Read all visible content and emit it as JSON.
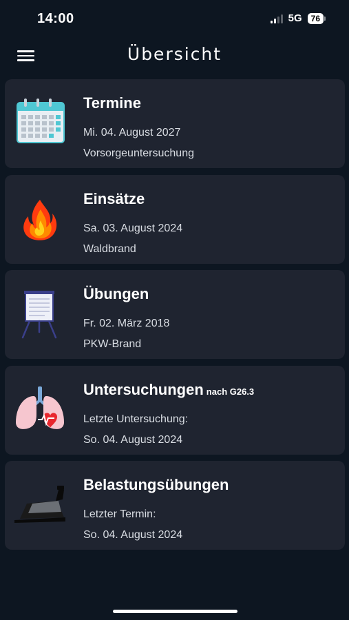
{
  "status_bar": {
    "time": "14:00",
    "network": "5G",
    "battery": "76"
  },
  "header": {
    "title": "Übersicht",
    "menu_icon": "hamburger-menu-icon"
  },
  "cards": [
    {
      "icon": "calendar-icon",
      "title": "Termine",
      "title_suffix": "",
      "line1": "Mi. 04. August 2027",
      "line2": "Vorsorgeuntersuchung"
    },
    {
      "icon": "fire-icon",
      "title": "Einsätze",
      "title_suffix": "",
      "line1": "Sa. 03. August 2024",
      "line2": "Waldbrand"
    },
    {
      "icon": "flipchart-icon",
      "title": "Übungen",
      "title_suffix": "",
      "line1": "Fr. 02. März 2018",
      "line2": "PKW-Brand"
    },
    {
      "icon": "lungs-heart-icon",
      "title": "Untersuchungen",
      "title_suffix": "nach G26.3",
      "line1": "Letzte Untersuchung:",
      "line2": "So. 04. August 2024"
    },
    {
      "icon": "treadmill-icon",
      "title": "Belastungsübungen",
      "title_suffix": "",
      "line1": "Letzter Termin:",
      "line2": "So. 04. August 2024"
    }
  ],
  "colors": {
    "background": "#0d1621",
    "card": "#1f2430",
    "text": "#ffffff",
    "subtext": "#d9dde3"
  }
}
